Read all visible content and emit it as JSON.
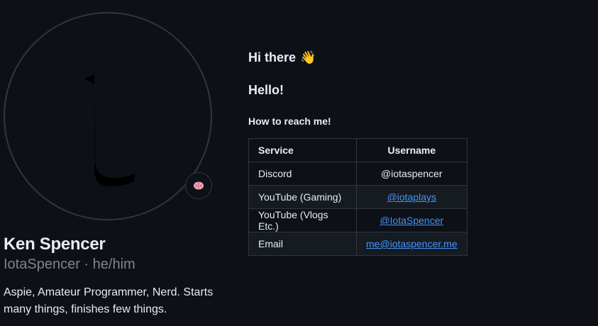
{
  "profile": {
    "full_name": "Ken Spencer",
    "username": "IotaSpencer",
    "separator": " · ",
    "pronouns": "he/him",
    "bio": "Aspie, Amateur Programmer, Nerd. Starts many things, finishes few things.",
    "avatar_glyph": "ι",
    "status_icon": "brain-icon"
  },
  "readme": {
    "greeting": "Hi there",
    "greeting_emoji": "👋",
    "hello": "Hello!",
    "reach_heading": "How to reach me!",
    "table": {
      "headers": [
        "Service",
        "Username"
      ],
      "rows": [
        {
          "service": "Discord",
          "username": "@iotaspencer",
          "is_link": false
        },
        {
          "service": "YouTube (Gaming)",
          "username": "@iotaplays",
          "is_link": true
        },
        {
          "service": "YouTube (Vlogs Etc.)",
          "username": "@IotaSpencer",
          "is_link": true
        },
        {
          "service": "Email",
          "username": "me@iotaspencer.me",
          "is_link": true
        }
      ]
    }
  },
  "colors": {
    "background": "#0d1117",
    "text": "#e6edf3",
    "muted": "#7d8590",
    "border": "#30363d",
    "link": "#4493f8"
  }
}
